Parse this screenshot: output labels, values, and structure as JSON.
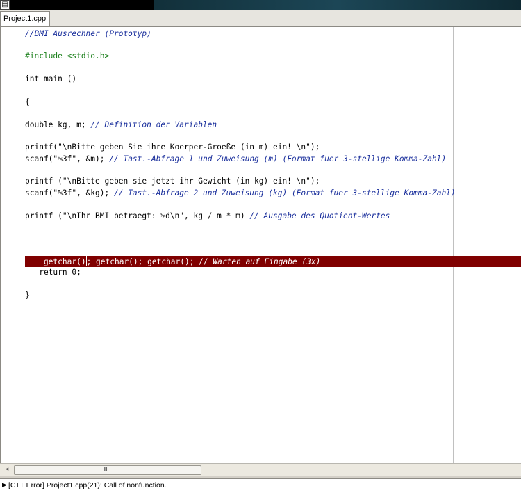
{
  "titlebar": {
    "system_icon": "window-menu-icon",
    "icon_glyph": "▤"
  },
  "tabs": [
    {
      "label": "Project1.cpp"
    }
  ],
  "editor": {
    "lines": [
      {
        "comment": "//BMI Ausrechner (Prototyp)"
      },
      {
        "preprocessor": "#include <stdio.h>"
      },
      {
        "code": "int main ()"
      },
      {
        "code": "{"
      },
      {
        "code": "double kg, m; ",
        "comment": "// Definition der Variablen"
      },
      {
        "code": "printf(\"\\nBitte geben Sie ihre Koerper-Groeße (in m) ein! \\n\");"
      },
      {
        "code": "scanf(\"%3f\", &m); ",
        "comment": "// Tast.-Abfrage 1 und Zuweisung (m) (Format fuer 3-stellige Komma-Zahl)"
      },
      {
        "code": "printf (\"\\nBitte geben sie jetzt ihr Gewicht (in kg) ein! \\n\");"
      },
      {
        "code": "scanf(\"%3f\", &kg); ",
        "comment": "// Tast.-Abfrage 2 und Zuweisung (kg) (Format fuer 3-stellige Komma-Zahl)"
      },
      {
        "code": "printf (\"\\nIhr BMI betraegt: %d\\n\", kg / m * m) ",
        "comment": "// Ausgabe des Quotient-Wertes"
      },
      {
        "code_before_caret": "    getchar()",
        "code_after_caret": "; getchar(); getchar(); ",
        "comment": "// Warten auf Eingabe (3x)"
      },
      {
        "code": "   return 0;"
      },
      {
        "code": "}"
      }
    ],
    "error_line_color": "#800000"
  },
  "scrollbar": {
    "left_arrow": "◂",
    "grip": "III"
  },
  "message": {
    "arrow": "▶",
    "text": "[C++ Error] Project1.cpp(21): Call of nonfunction."
  }
}
